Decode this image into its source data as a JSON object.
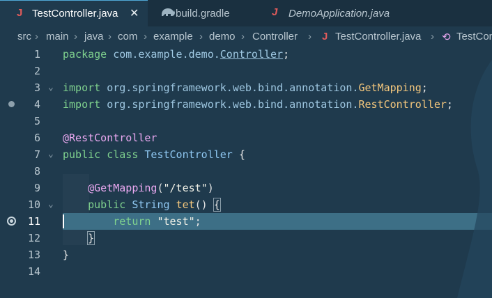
{
  "tabs": [
    {
      "label": "TestController.java",
      "icon": "java-icon",
      "active": true
    },
    {
      "label": "build.gradle",
      "icon": "gradle-icon",
      "active": false
    },
    {
      "label": "DemoApplication.java",
      "icon": "java-icon",
      "active": false
    }
  ],
  "breadcrumb": [
    "src",
    "main",
    "java",
    "com",
    "example",
    "demo",
    "Controller",
    "TestController.java",
    "TestCon"
  ],
  "editor": {
    "line_numbers": [
      "1",
      "2",
      "3",
      "4",
      "5",
      "6",
      "7",
      "8",
      "9",
      "10",
      "11",
      "12",
      "13",
      "14"
    ],
    "line1": {
      "kw": "package",
      "pkg": "com.example.demo.",
      "cls": "Controller",
      "end": ";"
    },
    "line3": {
      "kw": "import",
      "pkg": "org.springframework.web.bind.annotation.",
      "cls": "GetMapping",
      "end": ";"
    },
    "line4": {
      "kw": "import",
      "pkg": "org.springframework.web.bind.annotation.",
      "cls": "RestController",
      "end": ";"
    },
    "line6": {
      "ann": "@RestController"
    },
    "line7": {
      "kw1": "public",
      "kw2": "class",
      "name": "TestController",
      "brace": "{"
    },
    "line9": {
      "ann": "@GetMapping",
      "open": "(",
      "str": "\"/test\"",
      "close": ")"
    },
    "line10": {
      "kw": "public",
      "type": "String",
      "name": "tet",
      "parens": "()",
      "brace": "{"
    },
    "line11": {
      "kw": "return",
      "str": "\"test\"",
      "end": ";"
    },
    "line12": {
      "brace": "}"
    },
    "line13": {
      "brace": "}"
    }
  },
  "colors": {
    "accent": "#4fa8d6",
    "bg": "#1f3a4d",
    "current_line": "#3d6f86"
  }
}
